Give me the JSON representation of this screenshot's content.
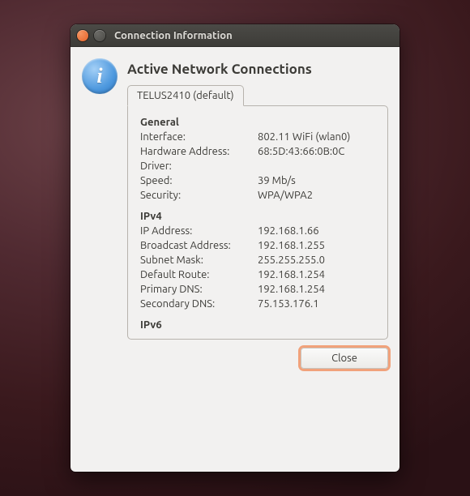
{
  "window": {
    "title": "Connection Information"
  },
  "heading": "Active Network Connections",
  "tab": {
    "label": "TELUS2410 (default)"
  },
  "sections": {
    "general": {
      "title": "General",
      "interface_k": "Interface:",
      "interface_v": "802.11 WiFi (wlan0)",
      "hwaddr_k": "Hardware Address:",
      "hwaddr_v": "68:5D:43:66:0B:0C",
      "driver_k": "Driver:",
      "driver_v": "",
      "speed_k": "Speed:",
      "speed_v": "39 Mb/s",
      "security_k": "Security:",
      "security_v": "WPA/WPA2"
    },
    "ipv4": {
      "title": "IPv4",
      "ip_k": "IP Address:",
      "ip_v": "192.168.1.66",
      "bcast_k": "Broadcast Address:",
      "bcast_v": "192.168.1.255",
      "mask_k": "Subnet Mask:",
      "mask_v": "255.255.255.0",
      "route_k": "Default Route:",
      "route_v": "192.168.1.254",
      "pdns_k": "Primary DNS:",
      "pdns_v": "192.168.1.254",
      "sdns_k": "Secondary DNS:",
      "sdns_v": "75.153.176.1"
    },
    "ipv6": {
      "title": "IPv6"
    }
  },
  "buttons": {
    "close": "Close"
  }
}
